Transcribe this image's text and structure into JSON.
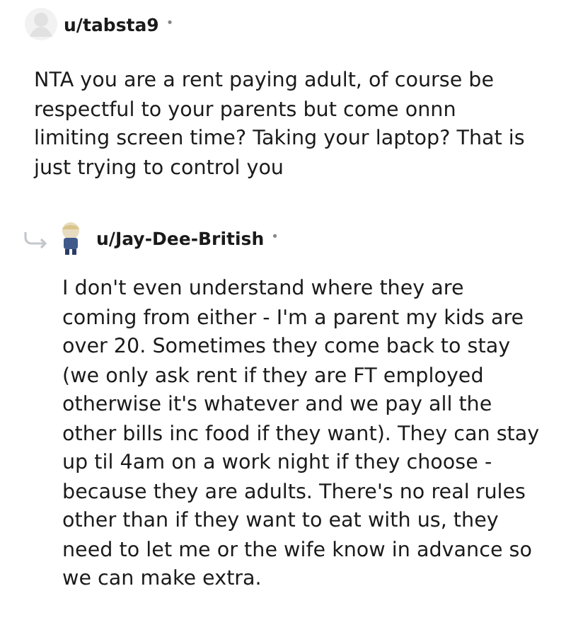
{
  "comments": [
    {
      "kind": "top",
      "author": "u/tabsta9",
      "separator": "•",
      "body": "NTA you are a rent paying adult, of course be respectful to your parents but come onnn limiting screen time? Taking your laptop? That is just trying to control you"
    },
    {
      "kind": "reply",
      "author": "u/Jay-Dee-British",
      "separator": "•",
      "body": "I don't even understand where they are coming from either - I'm a parent my kids are over 20. Sometimes they come back to stay (we only ask rent if they are FT employed otherwise it's whatever and we pay all the other bills inc food if they want). They can stay up til 4am on a work night if they choose - because they are adults. There's no real rules other than if they want to eat with us, they need to let me or the wife know in advance so we can make extra."
    }
  ]
}
